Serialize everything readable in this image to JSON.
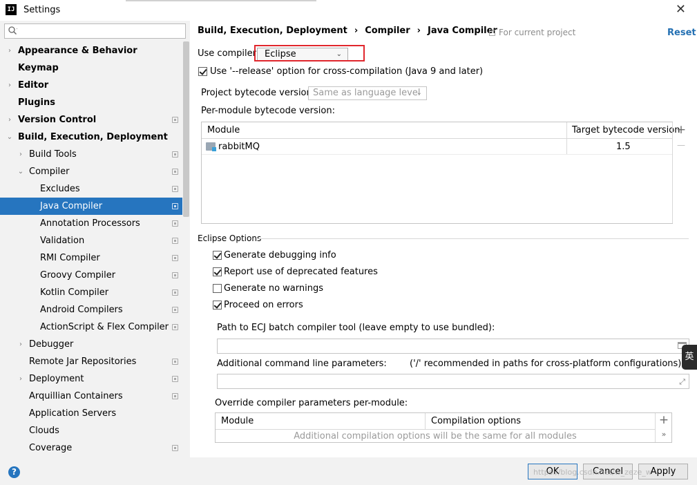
{
  "window": {
    "title": "Settings",
    "app_icon_text": "IJ",
    "close_glyph": "✕"
  },
  "search": {
    "placeholder": "",
    "value": ""
  },
  "sidebar": {
    "items": [
      {
        "label": "Appearance & Behavior",
        "level": 0,
        "arrow": "›",
        "bold": true,
        "proj": false,
        "selected": false
      },
      {
        "label": "Keymap",
        "level": 0,
        "arrow": "",
        "bold": true,
        "proj": false,
        "selected": false
      },
      {
        "label": "Editor",
        "level": 0,
        "arrow": "›",
        "bold": true,
        "proj": false,
        "selected": false
      },
      {
        "label": "Plugins",
        "level": 0,
        "arrow": "",
        "bold": true,
        "proj": false,
        "selected": false
      },
      {
        "label": "Version Control",
        "level": 0,
        "arrow": "›",
        "bold": true,
        "proj": true,
        "selected": false
      },
      {
        "label": "Build, Execution, Deployment",
        "level": 0,
        "arrow": "⌄",
        "bold": true,
        "proj": false,
        "selected": false
      },
      {
        "label": "Build Tools",
        "level": 1,
        "arrow": "›",
        "bold": false,
        "proj": true,
        "selected": false
      },
      {
        "label": "Compiler",
        "level": 1,
        "arrow": "⌄",
        "bold": false,
        "proj": true,
        "selected": false
      },
      {
        "label": "Excludes",
        "level": 2,
        "arrow": "",
        "bold": false,
        "proj": true,
        "selected": false
      },
      {
        "label": "Java Compiler",
        "level": 2,
        "arrow": "",
        "bold": false,
        "proj": true,
        "selected": true
      },
      {
        "label": "Annotation Processors",
        "level": 2,
        "arrow": "",
        "bold": false,
        "proj": true,
        "selected": false
      },
      {
        "label": "Validation",
        "level": 2,
        "arrow": "",
        "bold": false,
        "proj": true,
        "selected": false
      },
      {
        "label": "RMI Compiler",
        "level": 2,
        "arrow": "",
        "bold": false,
        "proj": true,
        "selected": false
      },
      {
        "label": "Groovy Compiler",
        "level": 2,
        "arrow": "",
        "bold": false,
        "proj": true,
        "selected": false
      },
      {
        "label": "Kotlin Compiler",
        "level": 2,
        "arrow": "",
        "bold": false,
        "proj": true,
        "selected": false
      },
      {
        "label": "Android Compilers",
        "level": 2,
        "arrow": "",
        "bold": false,
        "proj": true,
        "selected": false
      },
      {
        "label": "ActionScript & Flex Compiler",
        "level": 2,
        "arrow": "",
        "bold": false,
        "proj": true,
        "selected": false
      },
      {
        "label": "Debugger",
        "level": 1,
        "arrow": "›",
        "bold": false,
        "proj": false,
        "selected": false
      },
      {
        "label": "Remote Jar Repositories",
        "level": 1,
        "arrow": "",
        "bold": false,
        "proj": true,
        "selected": false
      },
      {
        "label": "Deployment",
        "level": 1,
        "arrow": "›",
        "bold": false,
        "proj": true,
        "selected": false
      },
      {
        "label": "Arquillian Containers",
        "level": 1,
        "arrow": "",
        "bold": false,
        "proj": true,
        "selected": false
      },
      {
        "label": "Application Servers",
        "level": 1,
        "arrow": "",
        "bold": false,
        "proj": false,
        "selected": false
      },
      {
        "label": "Clouds",
        "level": 1,
        "arrow": "",
        "bold": false,
        "proj": false,
        "selected": false
      },
      {
        "label": "Coverage",
        "level": 1,
        "arrow": "",
        "bold": false,
        "proj": true,
        "selected": false
      }
    ]
  },
  "header": {
    "breadcrumb": [
      "Build, Execution, Deployment",
      "Compiler",
      "Java Compiler"
    ],
    "breadcrumb_sep": "›",
    "for_project": "For current project",
    "reset": "Reset"
  },
  "compiler": {
    "use_compiler_label": "Use compiler:",
    "use_compiler_value": "Eclipse",
    "release_option_label": "Use '--release' option for cross-compilation (Java 9 and later)",
    "release_option_checked": true,
    "bytecode_label": "Project bytecode version:",
    "bytecode_value": "Same as language level",
    "per_module_label": "Per-module bytecode version:"
  },
  "module_table": {
    "headers": [
      "Module",
      "Target bytecode version"
    ],
    "rows": [
      {
        "module": "rabbitMQ",
        "version": "1.5"
      }
    ],
    "add": "+",
    "remove": "—"
  },
  "eclipse_options": {
    "group_label": "Eclipse Options",
    "checks": [
      {
        "label": "Generate debugging info",
        "checked": true
      },
      {
        "label": "Report use of deprecated features",
        "checked": true
      },
      {
        "label": "Generate no warnings",
        "checked": false
      },
      {
        "label": "Proceed on errors",
        "checked": true
      }
    ],
    "ecj_path_label": "Path to ECJ batch compiler tool (leave empty to use bundled):",
    "ecj_path_value": "",
    "params_label": "Additional command line parameters:",
    "params_hint": "('/' recommended in paths for cross-platform configurations)",
    "params_value": "",
    "expand_glyph": "⤢"
  },
  "override": {
    "label": "Override compiler parameters per-module:",
    "headers": [
      "Module",
      "Compilation options"
    ],
    "empty_text": "Additional compilation options will be the same for all modules",
    "add": "+",
    "more": "»"
  },
  "footer": {
    "help": "?",
    "ok": "OK",
    "cancel": "Cancel",
    "apply": "Apply",
    "watermark": "https://blog.csdn.net/w_zeze_w"
  },
  "ime": {
    "label": "英"
  },
  "colors": {
    "accent": "#2675bf",
    "highlight": "#e0262c",
    "link": "#2470b3"
  }
}
